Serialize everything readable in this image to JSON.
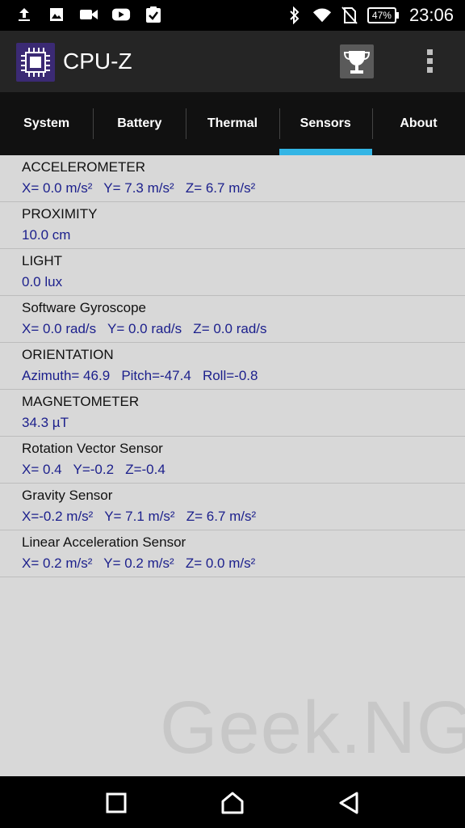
{
  "status_bar": {
    "time": "23:06",
    "battery": "47%",
    "left_icons": [
      "upload-icon",
      "image-icon",
      "video-icon",
      "youtube-icon",
      "clipboard-check-icon"
    ],
    "right_icons": [
      "bluetooth-icon",
      "wifi-icon",
      "no-sim-icon",
      "battery-icon"
    ]
  },
  "app_bar": {
    "title": "CPU-Z"
  },
  "tabs": [
    {
      "label": "System"
    },
    {
      "label": "Battery"
    },
    {
      "label": "Thermal"
    },
    {
      "label": "Sensors",
      "active": true
    },
    {
      "label": "About"
    }
  ],
  "sensors": [
    {
      "name": "ACCELEROMETER",
      "value": "X= 0.0 m/s²   Y= 7.3 m/s²   Z= 6.7 m/s²"
    },
    {
      "name": "PROXIMITY",
      "value": "10.0 cm"
    },
    {
      "name": "LIGHT",
      "value": "0.0 lux"
    },
    {
      "name": "Software Gyroscope",
      "value": "X= 0.0 rad/s   Y= 0.0 rad/s   Z= 0.0 rad/s"
    },
    {
      "name": "ORIENTATION",
      "value": "Azimuth= 46.9   Pitch=-47.4   Roll=-0.8"
    },
    {
      "name": "MAGNETOMETER",
      "value": "34.3 µT"
    },
    {
      "name": "Rotation Vector Sensor",
      "value": "X= 0.4   Y=-0.2   Z=-0.4"
    },
    {
      "name": "Gravity Sensor",
      "value": "X=-0.2 m/s²   Y= 7.1 m/s²   Z= 6.7 m/s²"
    },
    {
      "name": "Linear Acceleration Sensor",
      "value": "X= 0.2 m/s²   Y= 0.2 m/s²   Z= 0.0 m/s²"
    }
  ],
  "watermark": "Geek.NG",
  "colors": {
    "accent": "#33b5e5",
    "value_text": "#1b1f8c",
    "background": "#d8d8d8",
    "app_bar": "#252525",
    "tab_bar": "#111111"
  }
}
